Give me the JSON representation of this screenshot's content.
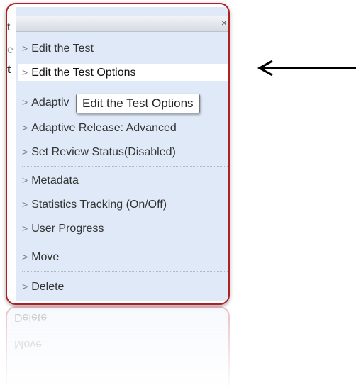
{
  "menu": {
    "close_label": "×",
    "items": [
      {
        "label": "Edit the Test"
      },
      {
        "label": "Edit the Test Options"
      },
      {
        "label": "Adaptiv"
      },
      {
        "label": "Adaptive Release: Advanced"
      },
      {
        "label": "Set Review Status(Disabled)"
      },
      {
        "label": "Metadata"
      },
      {
        "label": "Statistics Tracking (On/Off)"
      },
      {
        "label": "User Progress"
      },
      {
        "label": "Move"
      },
      {
        "label": "Delete"
      }
    ],
    "chevron": ">"
  },
  "tooltip": {
    "text": "Edit the Test Options"
  },
  "edge_glyphs": [
    "t",
    "e",
    "t"
  ],
  "reflection": {
    "items": [
      "Delete",
      "Move"
    ]
  },
  "colors": {
    "frame_border": "#b01f24",
    "menu_bg": "#dfe9f7",
    "active_bg": "#ffffff"
  },
  "icons": {
    "close": "close-icon",
    "chevron": "chevron-right-icon",
    "arrow": "arrow-left-icon"
  }
}
